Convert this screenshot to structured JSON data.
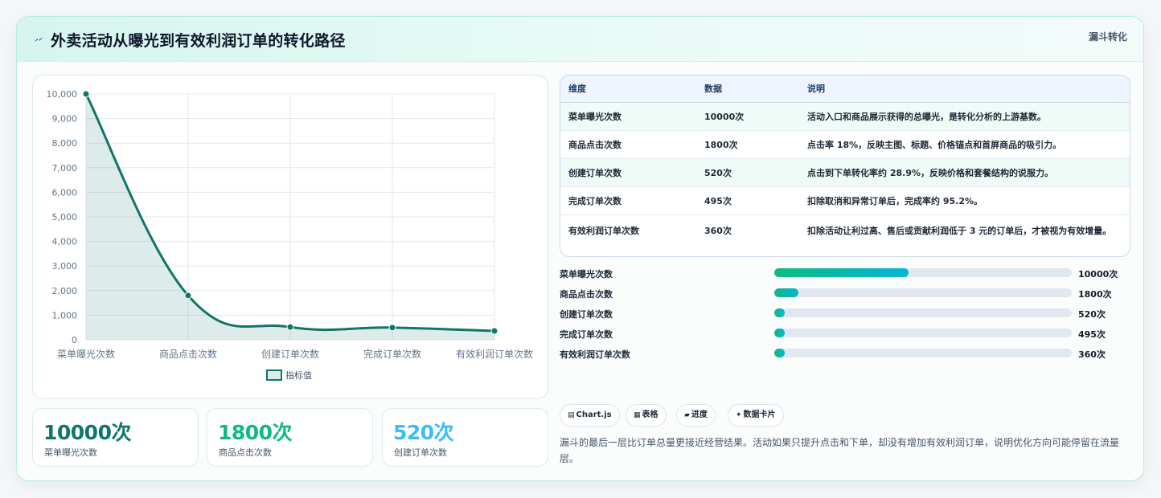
{
  "header": {
    "title": "外卖活动从曝光到有效利润订单的转化路径",
    "tag": "漏斗转化",
    "icon": "lightning-icon"
  },
  "chart_data": {
    "type": "line",
    "categories": [
      "菜单曝光次数",
      "商品点击次数",
      "创建订单次数",
      "完成订单次数",
      "有效利润订单次数"
    ],
    "series": [
      {
        "name": "指标值",
        "values": [
          10000,
          1800,
          520,
          495,
          360
        ]
      }
    ],
    "ylim": [
      0,
      10000
    ],
    "yticks": [
      "10,000",
      "9,000",
      "8,000",
      "7,000",
      "6,000",
      "5,000",
      "4,000",
      "3,000",
      "2,000",
      "1,000",
      "0"
    ],
    "fill": true,
    "grid": true,
    "legend": "bottom",
    "color": "#11766a"
  },
  "stats": [
    {
      "value": "10000次",
      "label": "菜单曝光次数",
      "color": "#0f766e"
    },
    {
      "value": "1800次",
      "label": "商品点击次数",
      "color": "#10b981"
    },
    {
      "value": "520次",
      "label": "创建订单次数",
      "color": "#38bdf8"
    }
  ],
  "table": {
    "headers": [
      "维度",
      "数据",
      "说明"
    ],
    "rows": [
      {
        "name": "菜单曝光次数",
        "value": "10000次",
        "desc": "活动入口和商品展示获得的总曝光，是转化分析的上游基数。"
      },
      {
        "name": "商品点击次数",
        "value": "1800次",
        "desc": "点击率 18%，反映主图、标题、价格锚点和首屏商品的吸引力。"
      },
      {
        "name": "创建订单次数",
        "value": "520次",
        "desc": "点击到下单转化率约 28.9%，反映价格和套餐结构的说服力。"
      },
      {
        "name": "完成订单次数",
        "value": "495次",
        "desc": "扣除取消和异常订单后，完成率约 95.2%。"
      },
      {
        "name": "有效利润订单次数",
        "value": "360次",
        "desc": "扣除活动让利过高、售后或贡献利润低于 3 元的订单后，才被视为有效增量。"
      }
    ]
  },
  "bars": [
    {
      "label": "菜单曝光次数",
      "value": "10000次",
      "fraction": 0.45
    },
    {
      "label": "商品点击次数",
      "value": "1800次",
      "fraction": 0.081
    },
    {
      "label": "创建订单次数",
      "value": "520次",
      "fraction": 0.034
    },
    {
      "label": "完成订单次数",
      "value": "495次",
      "fraction": 0.034
    },
    {
      "label": "有效利润订单次数",
      "value": "360次",
      "fraction": 0.034
    }
  ],
  "chips": [
    {
      "icon": "▤",
      "label": "Chart.js"
    },
    {
      "icon": "▦",
      "label": "表格"
    },
    {
      "icon": "▰",
      "label": "进度"
    },
    {
      "icon": "✦",
      "label": "数据卡片"
    }
  ],
  "note": "漏斗的最后一层比订单总量更接近经营结果。活动如果只提升点击和下单，却没有增加有效利润订单，说明优化方向可能停留在流量层。"
}
